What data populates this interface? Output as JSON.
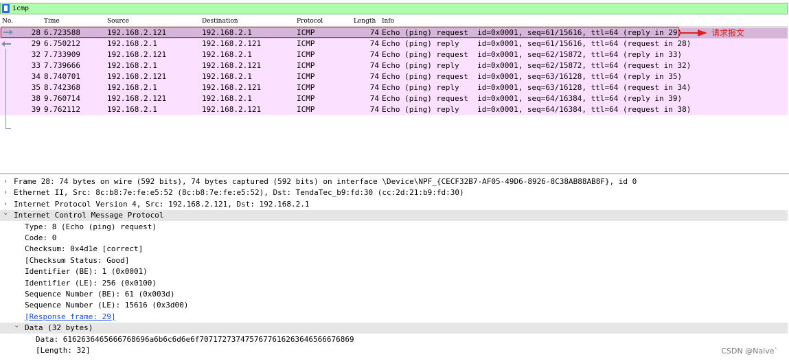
{
  "filter": {
    "text": "icmp"
  },
  "columns": {
    "no": "No.",
    "time": "Time",
    "source": "Source",
    "destination": "Destination",
    "protocol": "Protocol",
    "length": "Length",
    "info": "Info"
  },
  "packets": [
    {
      "no": "28",
      "time": "6.723588",
      "src": "192.168.2.121",
      "dst": "192.168.2.1",
      "proto": "ICMP",
      "len": "74",
      "info": "Echo (ping) request  id=0x0001, seq=61/15616, ttl=64 (reply in 29)"
    },
    {
      "no": "29",
      "time": "6.750212",
      "src": "192.168.2.1",
      "dst": "192.168.2.121",
      "proto": "ICMP",
      "len": "74",
      "info": "Echo (ping) reply    id=0x0001, seq=61/15616, ttl=64 (request in 28)"
    },
    {
      "no": "32",
      "time": "7.733909",
      "src": "192.168.2.121",
      "dst": "192.168.2.1",
      "proto": "ICMP",
      "len": "74",
      "info": "Echo (ping) request  id=0x0001, seq=62/15872, ttl=64 (reply in 33)"
    },
    {
      "no": "33",
      "time": "7.739666",
      "src": "192.168.2.1",
      "dst": "192.168.2.121",
      "proto": "ICMP",
      "len": "74",
      "info": "Echo (ping) reply    id=0x0001, seq=62/15872, ttl=64 (request in 32)"
    },
    {
      "no": "34",
      "time": "8.740701",
      "src": "192.168.2.121",
      "dst": "192.168.2.1",
      "proto": "ICMP",
      "len": "74",
      "info": "Echo (ping) request  id=0x0001, seq=63/16128, ttl=64 (reply in 35)"
    },
    {
      "no": "35",
      "time": "8.742368",
      "src": "192.168.2.1",
      "dst": "192.168.2.121",
      "proto": "ICMP",
      "len": "74",
      "info": "Echo (ping) reply    id=0x0001, seq=63/16128, ttl=64 (request in 34)"
    },
    {
      "no": "38",
      "time": "9.760714",
      "src": "192.168.2.121",
      "dst": "192.168.2.1",
      "proto": "ICMP",
      "len": "74",
      "info": "Echo (ping) request  id=0x0001, seq=64/16384, ttl=64 (reply in 39)"
    },
    {
      "no": "39",
      "time": "9.762112",
      "src": "192.168.2.1",
      "dst": "192.168.2.121",
      "proto": "ICMP",
      "len": "74",
      "info": "Echo (ping) reply    id=0x0001, seq=64/16384, ttl=64 (request in 38)"
    }
  ],
  "annotation": {
    "label": "请求报文"
  },
  "details": {
    "frame": "Frame 28: 74 bytes on wire (592 bits), 74 bytes captured (592 bits) on interface \\Device\\NPF_{CECF32B7-AF05-49D6-8926-8C38AB88AB8F}, id 0",
    "ethernet": "Ethernet II, Src: 8c:b8:7e:fe:e5:52 (8c:b8:7e:fe:e5:52), Dst: TendaTec_b9:fd:30 (cc:2d:21:b9:fd:30)",
    "ip": "Internet Protocol Version 4, Src: 192.168.2.121, Dst: 192.168.2.1",
    "icmp": "Internet Control Message Protocol",
    "type": "Type: 8 (Echo (ping) request)",
    "code": "Code: 0",
    "checksum": "Checksum: 0x4d1e [correct]",
    "checksum_status": "[Checksum Status: Good]",
    "id_be": "Identifier (BE): 1 (0x0001)",
    "id_le": "Identifier (LE): 256 (0x0100)",
    "seq_be": "Sequence Number (BE): 61 (0x003d)",
    "seq_le": "Sequence Number (LE): 15616 (0x3d00)",
    "response_frame": "[Response frame: 29]",
    "data": "Data (32 bytes)",
    "data_value": "Data: 6162636465666768696a6b6c6d6e6f7071727374757677616263646566676869",
    "data_length": "[Length: 32]"
  },
  "expanders": {
    "collapsed": "›",
    "expanded": "⌄"
  },
  "watermark": "CSDN @Naive`"
}
